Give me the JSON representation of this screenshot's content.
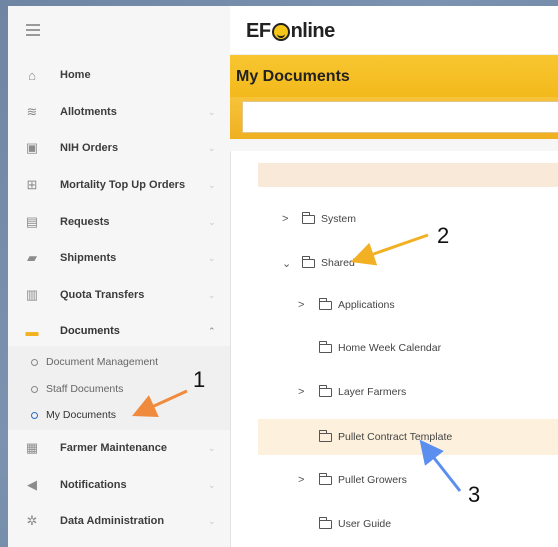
{
  "app": {
    "logo_pre": "EF",
    "logo_post": "nline"
  },
  "page": {
    "title": "My Documents"
  },
  "sidebar": {
    "items": [
      {
        "label": "Home",
        "icon": "home-icon"
      },
      {
        "label": "Allotments",
        "icon": "layers-icon"
      },
      {
        "label": "NIH Orders",
        "icon": "cart-icon"
      },
      {
        "label": "Mortality Top Up Orders",
        "icon": "plus-box-icon"
      },
      {
        "label": "Requests",
        "icon": "clipboard-icon"
      },
      {
        "label": "Shipments",
        "icon": "truck-icon"
      },
      {
        "label": "Quota Transfers",
        "icon": "bar-chart-icon"
      },
      {
        "label": "Documents",
        "icon": "folder-icon"
      },
      {
        "label": "Farmer Maintenance",
        "icon": "building-icon"
      },
      {
        "label": "Notifications",
        "icon": "megaphone-icon"
      },
      {
        "label": "Data Administration",
        "icon": "gear-icon"
      }
    ],
    "documents_sub": [
      {
        "label": "Document Management"
      },
      {
        "label": "Staff Documents"
      },
      {
        "label": "My Documents"
      }
    ]
  },
  "tree": {
    "nodes": [
      {
        "label": "System",
        "expand": "collapsed"
      },
      {
        "label": "Shared",
        "expand": "expanded"
      },
      {
        "label": "Applications",
        "expand": "collapsed"
      },
      {
        "label": "Home Week Calendar",
        "expand": "none"
      },
      {
        "label": "Layer Farmers",
        "expand": "collapsed"
      },
      {
        "label": "Pullet Contract Template",
        "expand": "none"
      },
      {
        "label": "Pullet Growers",
        "expand": "collapsed"
      },
      {
        "label": "User Guide",
        "expand": "none"
      }
    ]
  },
  "annotations": {
    "n1": "1",
    "n2": "2",
    "n3": "3"
  },
  "colors": {
    "accent": "#f5b81f",
    "arrow_orange": "#f08a3c",
    "arrow_yellow": "#f2b125",
    "arrow_blue": "#5a8ff0"
  }
}
